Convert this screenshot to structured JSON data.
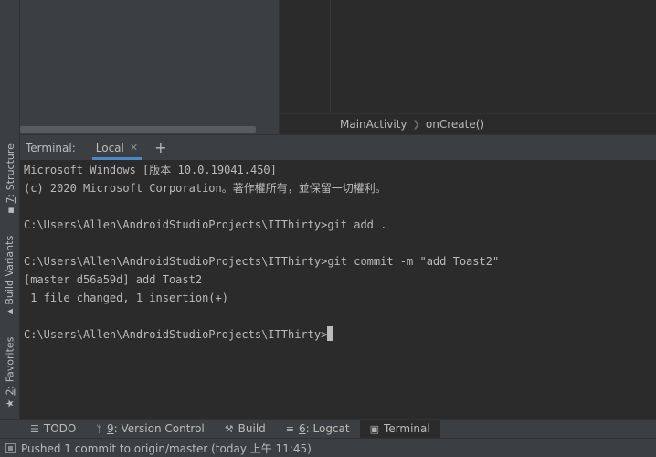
{
  "side_tabs": {
    "structure": {
      "num": "7",
      "label": ": Structure"
    },
    "build_variants": {
      "label": "Build Variants"
    },
    "favorites": {
      "num": "2",
      "label": ": Favorites"
    }
  },
  "editor": {
    "breadcrumb": [
      "MainActivity",
      "onCreate()"
    ]
  },
  "terminal": {
    "title": "Terminal:",
    "tab_label": "Local",
    "lines": [
      "Microsoft Windows [版本 10.0.19041.450]",
      "(c) 2020 Microsoft Corporation。著作權所有，並保留一切權利。",
      "",
      "C:\\Users\\Allen\\AndroidStudioProjects\\ITThirty>git add .",
      "",
      "C:\\Users\\Allen\\AndroidStudioProjects\\ITThirty>git commit -m \"add Toast2\"",
      "[master d56a59d] add Toast2",
      " 1 file changed, 1 insertion(+)",
      "",
      "C:\\Users\\Allen\\AndroidStudioProjects\\ITThirty>"
    ]
  },
  "bottom_tabs": [
    {
      "num": "",
      "label": "TODO",
      "icon": "list-icon"
    },
    {
      "num": "9",
      "label": ": Version Control",
      "icon": "branch-icon"
    },
    {
      "num": "",
      "label": "Build",
      "icon": "hammer-icon"
    },
    {
      "num": "6",
      "label": ": Logcat",
      "icon": "logcat-icon"
    },
    {
      "num": "",
      "label": "Terminal",
      "icon": "terminal-icon"
    }
  ],
  "status": {
    "message": "Pushed 1 commit to origin/master (today 上午 11:45)"
  }
}
